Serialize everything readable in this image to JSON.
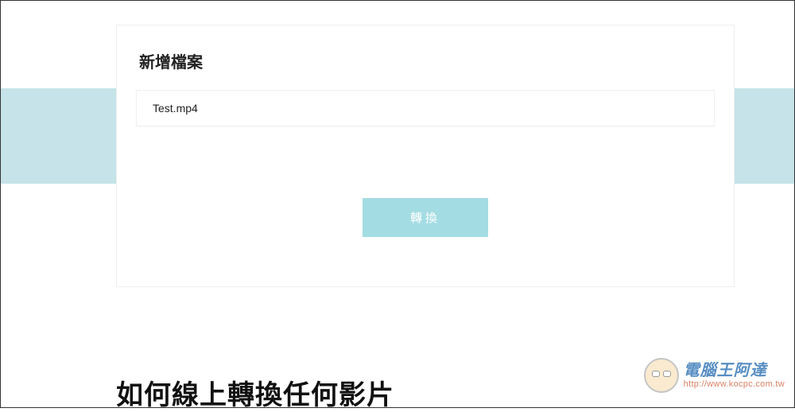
{
  "card": {
    "title": "新增檔案",
    "file_name": "Test.mp4",
    "convert_label": "轉換"
  },
  "heading_below": "如何線上轉換任何影片",
  "watermark": {
    "title": "電腦王阿達",
    "url": "http://www.kocpc.com.tw"
  }
}
